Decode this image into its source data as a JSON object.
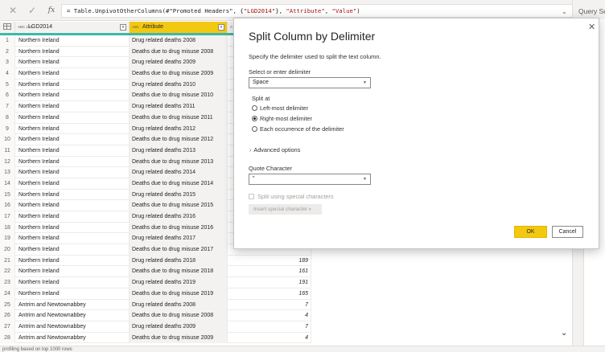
{
  "formula_bar": {
    "cancel_icon": "close-icon",
    "confirm_icon": "checkmark-icon",
    "fx_label": "fx",
    "formula_prefix": "= Table.UnpivotOtherColumns(#\"Promoted Headers\", {",
    "formula_arg1": "\"LGD2014\"",
    "formula_sep1": "}, ",
    "formula_arg2": "\"Attribute\"",
    "formula_sep2": ", ",
    "formula_arg3": "\"Value\"",
    "formula_suffix": ")",
    "expand_icon": "chevron-down-icon"
  },
  "grid": {
    "columns": [
      {
        "type_badge": "ABC 123",
        "label": "LGD2014"
      },
      {
        "type_badge": "ABC",
        "label": "Attribute"
      },
      {
        "type_badge": "A 1.2",
        "label": ""
      }
    ],
    "rows": [
      {
        "n": "1",
        "lgd": "Northern Ireland",
        "attr": "Drug related deaths 2008",
        "val": ""
      },
      {
        "n": "2",
        "lgd": "Northern Ireland",
        "attr": "Deaths due to drug misuse 2008",
        "val": ""
      },
      {
        "n": "3",
        "lgd": "Northern Ireland",
        "attr": "Drug related deaths 2009",
        "val": ""
      },
      {
        "n": "4",
        "lgd": "Northern Ireland",
        "attr": "Deaths due to drug misuse 2009",
        "val": ""
      },
      {
        "n": "5",
        "lgd": "Northern Ireland",
        "attr": "Drug related deaths 2010",
        "val": ""
      },
      {
        "n": "6",
        "lgd": "Northern Ireland",
        "attr": "Deaths due to drug misuse 2010",
        "val": ""
      },
      {
        "n": "7",
        "lgd": "Northern Ireland",
        "attr": "Drug related deaths 2011",
        "val": ""
      },
      {
        "n": "8",
        "lgd": "Northern Ireland",
        "attr": "Deaths due to drug misuse 2011",
        "val": ""
      },
      {
        "n": "9",
        "lgd": "Northern Ireland",
        "attr": "Drug related deaths 2012",
        "val": ""
      },
      {
        "n": "10",
        "lgd": "Northern Ireland",
        "attr": "Deaths due to drug misuse 2012",
        "val": ""
      },
      {
        "n": "11",
        "lgd": "Northern Ireland",
        "attr": "Drug related deaths 2013",
        "val": ""
      },
      {
        "n": "12",
        "lgd": "Northern Ireland",
        "attr": "Deaths due to drug misuse 2013",
        "val": ""
      },
      {
        "n": "13",
        "lgd": "Northern Ireland",
        "attr": "Drug related deaths 2014",
        "val": ""
      },
      {
        "n": "14",
        "lgd": "Northern Ireland",
        "attr": "Deaths due to drug misuse 2014",
        "val": ""
      },
      {
        "n": "15",
        "lgd": "Northern Ireland",
        "attr": "Drug related deaths 2015",
        "val": ""
      },
      {
        "n": "16",
        "lgd": "Northern Ireland",
        "attr": "Deaths due to drug misuse 2015",
        "val": ""
      },
      {
        "n": "17",
        "lgd": "Northern Ireland",
        "attr": "Drug related deaths 2016",
        "val": ""
      },
      {
        "n": "18",
        "lgd": "Northern Ireland",
        "attr": "Deaths due to drug misuse 2016",
        "val": ""
      },
      {
        "n": "19",
        "lgd": "Northern Ireland",
        "attr": "Drug related deaths 2017",
        "val": ""
      },
      {
        "n": "20",
        "lgd": "Northern Ireland",
        "attr": "Deaths due to drug misuse 2017",
        "val": ""
      },
      {
        "n": "21",
        "lgd": "Northern Ireland",
        "attr": "Drug related deaths 2018",
        "val": "189"
      },
      {
        "n": "22",
        "lgd": "Northern Ireland",
        "attr": "Deaths due to drug misuse 2018",
        "val": "161"
      },
      {
        "n": "23",
        "lgd": "Northern Ireland",
        "attr": "Drug related deaths 2019",
        "val": "191"
      },
      {
        "n": "24",
        "lgd": "Northern Ireland",
        "attr": "Deaths due to drug misuse 2019",
        "val": "165"
      },
      {
        "n": "25",
        "lgd": "Antrim and Newtownabbey",
        "attr": "Drug related deaths 2008",
        "val": "7"
      },
      {
        "n": "26",
        "lgd": "Antrim and Newtownabbey",
        "attr": "Deaths due to drug misuse 2008",
        "val": "4"
      },
      {
        "n": "27",
        "lgd": "Antrim and Newtownabbey",
        "attr": "Drug related deaths 2009",
        "val": "7"
      },
      {
        "n": "28",
        "lgd": "Antrim and Newtownabbey",
        "attr": "Deaths due to drug misuse 2009",
        "val": "4"
      }
    ]
  },
  "query_settings": {
    "title": "Query Se",
    "fragments": [
      "P",
      "N",
      "th",
      "A",
      "PE",
      "So",
      "Se",
      "Pr",
      "Ch",
      "Fi",
      "Re",
      "Ur"
    ]
  },
  "status_bar": {
    "text": "profiling based on top 1000 rows"
  },
  "dialog": {
    "title": "Split Column by Delimiter",
    "description": "Specify the delimiter used to split the text column.",
    "delimiter_label": "Select or enter delimiter",
    "delimiter_value": "Space",
    "split_at_label": "Split at",
    "options": [
      {
        "label": "Left-most delimiter",
        "selected": false
      },
      {
        "label": "Right-most delimiter",
        "selected": true
      },
      {
        "label": "Each occurrence of the delimiter",
        "selected": false
      }
    ],
    "advanced_label": "Advanced options",
    "quote_label": "Quote Character",
    "quote_value": "\"",
    "special_chars_label": "Split using special characters",
    "insert_special_label": "Insert special character",
    "ok_label": "OK",
    "cancel_label": "Cancel",
    "accent_color": "#f2c811"
  }
}
